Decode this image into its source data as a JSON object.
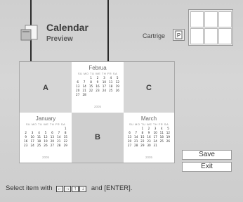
{
  "header": {
    "title": "Calendar",
    "subtitle": "Preview",
    "cartridge_label": "Cartrige",
    "cartridge_icon": "P"
  },
  "grid": {
    "slot_a": "A",
    "slot_b": "B",
    "slot_c": "C",
    "february": {
      "name": "Februa",
      "year": "2005",
      "week": "SU MO TU WE TH FR SA",
      "rows": [
        [
          "",
          "",
          "1",
          "2",
          "3",
          "4",
          "5"
        ],
        [
          "6",
          "7",
          "8",
          "9",
          "10",
          "11",
          "12"
        ],
        [
          "13",
          "14",
          "15",
          "16",
          "17",
          "18",
          "19"
        ],
        [
          "20",
          "21",
          "22",
          "23",
          "24",
          "25",
          "26"
        ],
        [
          "27",
          "28",
          "",
          "",
          "",
          "",
          ""
        ]
      ]
    },
    "january": {
      "name": "January",
      "year": "2005",
      "week": "SU MO TU WE TH FR SA",
      "rows": [
        [
          "",
          "",
          "",
          "",
          "",
          "",
          "1"
        ],
        [
          "2",
          "3",
          "4",
          "5",
          "6",
          "7",
          "8"
        ],
        [
          "9",
          "10",
          "11",
          "12",
          "13",
          "14",
          "15"
        ],
        [
          "16",
          "17",
          "18",
          "19",
          "20",
          "21",
          "22"
        ],
        [
          "23",
          "24",
          "25",
          "26",
          "27",
          "28",
          "29"
        ]
      ]
    },
    "march": {
      "name": "March",
      "year": "2005",
      "week": "SU MO TU WE TH FR SA",
      "rows": [
        [
          "",
          "",
          "1",
          "2",
          "3",
          "4",
          "5"
        ],
        [
          "6",
          "7",
          "8",
          "9",
          "10",
          "11",
          "12"
        ],
        [
          "13",
          "14",
          "15",
          "16",
          "17",
          "18",
          "19"
        ],
        [
          "20",
          "21",
          "22",
          "23",
          "24",
          "25",
          "26"
        ],
        [
          "27",
          "28",
          "29",
          "30",
          "31",
          "",
          ""
        ]
      ]
    }
  },
  "buttons": {
    "save": "Save",
    "exit": "Exit"
  },
  "footer": {
    "hint_prefix": "Select item with",
    "hint_suffix": "and [ENTER].",
    "keys": [
      "←",
      "→",
      "↑",
      "↓"
    ]
  },
  "colors": {
    "background": "#d2d2d2",
    "tile_blank": "#d6d6d6",
    "tile_white": "#ffffff",
    "text": "#333333"
  }
}
